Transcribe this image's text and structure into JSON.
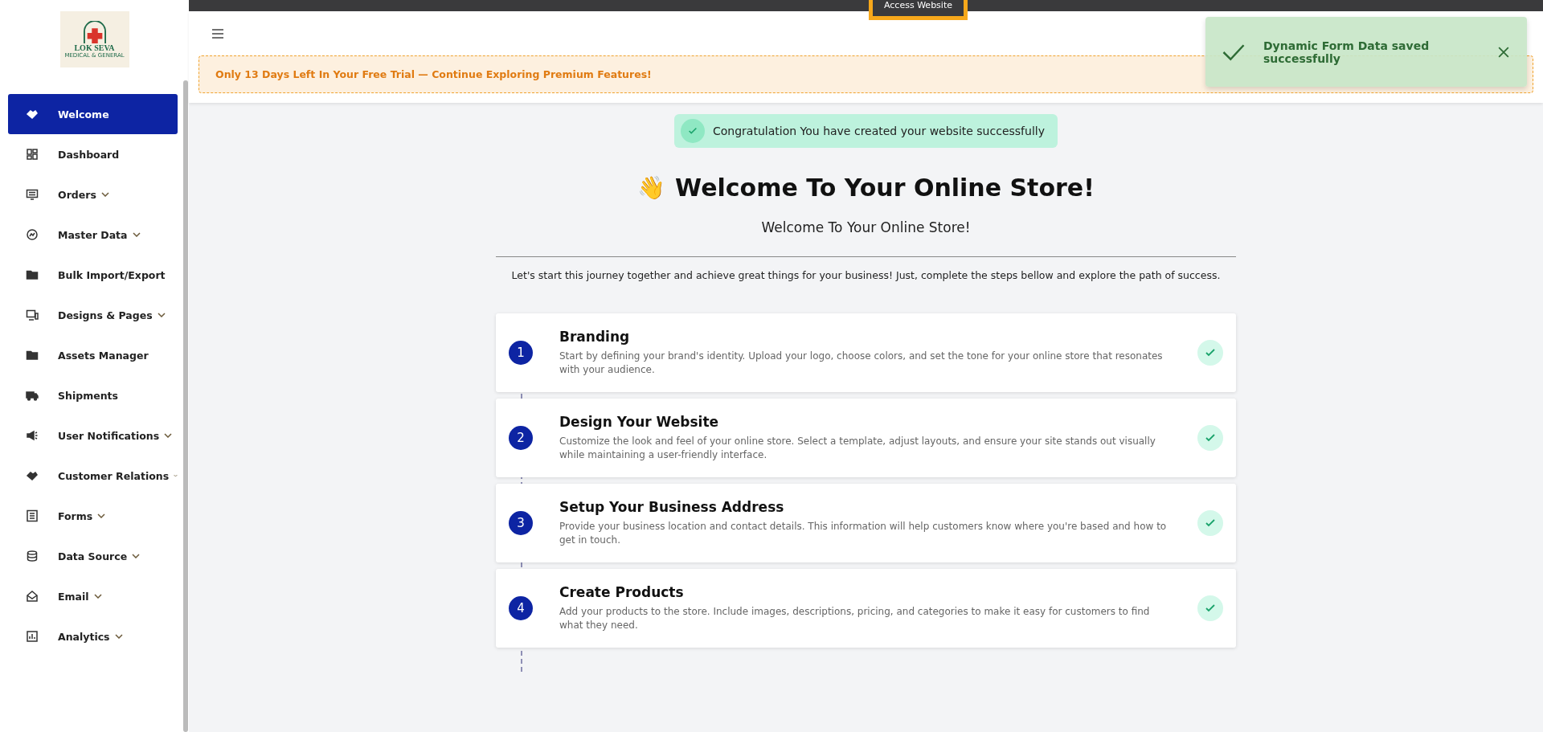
{
  "sidebar": {
    "logo": {
      "name": "LOK SEVA",
      "tagline": "MEDICAL & GENERAL"
    },
    "items": [
      {
        "label": "Welcome",
        "selected": true,
        "has_submenu": false
      },
      {
        "label": "Dashboard",
        "selected": false,
        "has_submenu": false
      },
      {
        "label": "Orders",
        "selected": false,
        "has_submenu": true
      },
      {
        "label": "Master Data",
        "selected": false,
        "has_submenu": true
      },
      {
        "label": "Bulk Import/Export",
        "selected": false,
        "has_submenu": false
      },
      {
        "label": "Designs & Pages",
        "selected": false,
        "has_submenu": true
      },
      {
        "label": "Assets Manager",
        "selected": false,
        "has_submenu": false
      },
      {
        "label": "Shipments",
        "selected": false,
        "has_submenu": false
      },
      {
        "label": "User Notifications",
        "selected": false,
        "has_submenu": true
      },
      {
        "label": "Customer Relations",
        "selected": false,
        "has_submenu": true
      },
      {
        "label": "Forms",
        "selected": false,
        "has_submenu": true
      },
      {
        "label": "Data Source",
        "selected": false,
        "has_submenu": true
      },
      {
        "label": "Email",
        "selected": false,
        "has_submenu": true
      },
      {
        "label": "Analytics",
        "selected": false,
        "has_submenu": true
      }
    ]
  },
  "top_bar": {
    "access_link": "Access Website"
  },
  "trial_banner": "Only 13 Days Left In Your Free Trial — Continue Exploring Premium Features!",
  "toast": {
    "message": "Dynamic Form Data saved successfully"
  },
  "welcome": {
    "success_message": "Congratulation You have created your website successfully",
    "emoji": "👋",
    "title": "Welcome To Your Online Store!",
    "subtitle": "Welcome To Your Online Store!",
    "intro": "Let's start this journey together and achieve great things for your business! Just, complete the steps bellow and explore the path of success."
  },
  "steps": [
    {
      "number": "1",
      "title": "Branding",
      "description": "Start by defining your brand's identity. Upload your logo, choose colors, and set the tone for your online store that resonates with your audience.",
      "completed": true
    },
    {
      "number": "2",
      "title": "Design Your Website",
      "description": "Customize the look and feel of your online store. Select a template, adjust layouts, and ensure your site stands out visually while maintaining a user-friendly interface.",
      "completed": true
    },
    {
      "number": "3",
      "title": "Setup Your Business Address",
      "description": "Provide your business location and contact details. This information will help customers know where you're based and how to get in touch.",
      "completed": true
    },
    {
      "number": "4",
      "title": "Create Products",
      "description": "Add your products to the store. Include images, descriptions, pricing, and categories to make it easy for customers to find what they need.",
      "completed": true
    }
  ]
}
